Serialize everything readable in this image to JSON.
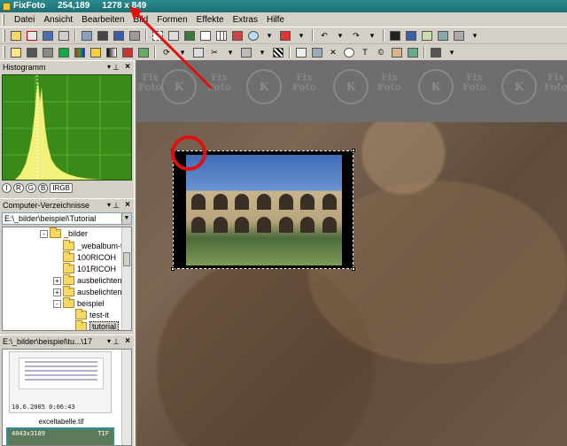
{
  "titlebar": {
    "app_name": "FixFoto",
    "coords": "254,189",
    "size": "1278 x 849"
  },
  "menu": [
    "Datei",
    "Ansicht",
    "Bearbeiten",
    "Bild",
    "Formen",
    "Effekte",
    "Extras",
    "Hilfe"
  ],
  "histogram": {
    "title": "Histogramm",
    "channels": [
      "I",
      "R",
      "G",
      "B",
      "IRGB"
    ],
    "active_channel": "IRGB"
  },
  "explorer": {
    "title": "Computer-Verzeichnisse",
    "path": "E:\\_bilder\\beispiel\\Tutorial",
    "tree": [
      {
        "label": "_bilder",
        "expander": "-"
      },
      {
        "label": "_webalbum-tes"
      },
      {
        "label": "100RICOH"
      },
      {
        "label": "101RICOH"
      },
      {
        "label": "ausbelichten",
        "expander": "+"
      },
      {
        "label": "ausbelichten-m",
        "expander": "+"
      },
      {
        "label": "beispiel",
        "expander": "-"
      },
      {
        "label": "test-it"
      },
      {
        "label": "tutorial"
      }
    ]
  },
  "browser": {
    "title": "E:\\_bilder\\beispiel\\tu...\\17",
    "thumb1_date": "10.6.2005 0:06:43",
    "thumb1_caption": "exceltabelle.tif",
    "thumb2_dims": "4043x3189",
    "thumb2_format": "TIF"
  },
  "watermark": {
    "word_a": "Fix",
    "word_b": "Foto",
    "mark": "K"
  },
  "colors": {
    "title_bg": "#1c6f73",
    "annotation_red": "#e01010",
    "histogram_bg": "#3a8a19",
    "histogram_fill": "#f2f27a"
  }
}
